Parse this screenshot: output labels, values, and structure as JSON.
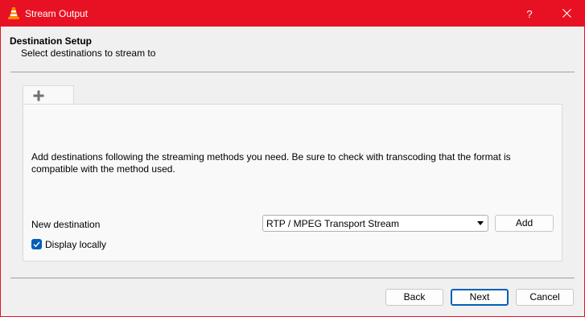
{
  "window": {
    "title": "Stream Output",
    "help_label": "?",
    "icons": {
      "app": "vlc-cone-icon",
      "close": "close-icon"
    },
    "colors": {
      "titlebar": "#e81123",
      "accent": "#005fb8"
    }
  },
  "header": {
    "title": "Destination Setup",
    "subtitle": "Select destinations to stream to"
  },
  "tabs": [
    {
      "icon": "plus-icon",
      "selected": true
    }
  ],
  "panel": {
    "info": "Add destinations following the streaming methods you need. Be sure to check with transcoding that the format is compatible with the method used.",
    "new_destination_label": "New destination",
    "destination_select": {
      "value": "RTP / MPEG Transport Stream"
    },
    "add_label": "Add",
    "display_locally": {
      "label": "Display locally",
      "checked": true
    }
  },
  "footer": {
    "back_label": "Back",
    "next_label": "Next",
    "cancel_label": "Cancel"
  }
}
